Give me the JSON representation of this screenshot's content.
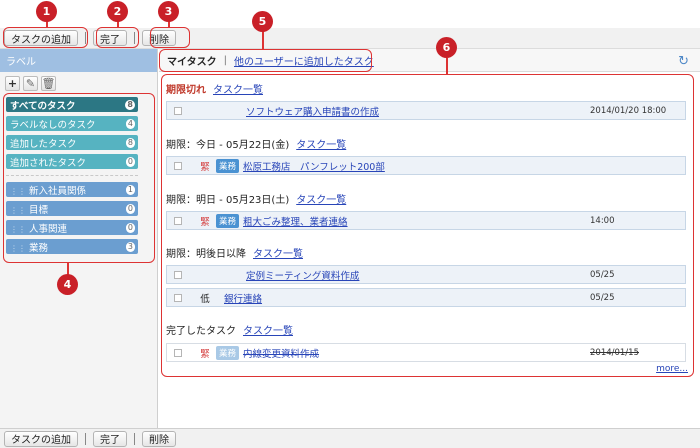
{
  "toolbar": {
    "add_task": "タスクの追加",
    "complete": "完了",
    "delete": "削除"
  },
  "sidebar": {
    "header": "ラベル",
    "icons": [
      "plus-icon",
      "pencil-icon",
      "trash-icon"
    ],
    "labels": [
      {
        "name": "すべてのタスク",
        "count": "8"
      },
      {
        "name": "ラベルなしのタスク",
        "count": "4"
      },
      {
        "name": "追加したタスク",
        "count": "8"
      },
      {
        "name": "追加されたタスク",
        "count": "0"
      },
      {
        "name": "新入社員関係",
        "count": "1"
      },
      {
        "name": "目標",
        "count": "0"
      },
      {
        "name": "人事関連",
        "count": "0"
      },
      {
        "name": "業務",
        "count": "3"
      }
    ]
  },
  "main": {
    "tab_my": "マイタスク",
    "tab_other": "他のユーザーに追加したタスク",
    "task_list_link": "タスク一覧",
    "more": "more...",
    "sections": [
      {
        "title": "期限切れ"
      },
      {
        "title": "期限：今日 - 05月22日(金)"
      },
      {
        "title": "期限：明日 - 05月23日(土)"
      },
      {
        "title": "期限：明後日以降"
      },
      {
        "title": "完了したタスク"
      }
    ],
    "rows": [
      {
        "priority": "",
        "tag": "",
        "task": "ソフトウェア購入申請書の作成",
        "date": "2014/01/20 18:00"
      },
      {
        "priority": "緊",
        "tag": "業務",
        "task": "松原工務店　パンフレット200部",
        "date": ""
      },
      {
        "priority": "緊",
        "tag": "業務",
        "task": "粗大ごみ整理、業者連絡",
        "date": "14:00"
      },
      {
        "priority": "",
        "tag": "",
        "task": "定例ミーティング資料作成",
        "date": "05/25"
      },
      {
        "priority": "低",
        "tag": "",
        "task": "銀行連絡",
        "date": "05/25"
      },
      {
        "priority": "緊",
        "tag": "業務",
        "task": "内線変更資料作成",
        "date": "2014/01/15"
      }
    ]
  },
  "callouts": [
    "1",
    "2",
    "3",
    "4",
    "5",
    "6"
  ],
  "colors": {
    "callout": "#c92028",
    "link": "#2845b8",
    "label_dark": "#2c7784",
    "label_teal": "#56b3c1",
    "label_blue": "#6b9ed0"
  }
}
